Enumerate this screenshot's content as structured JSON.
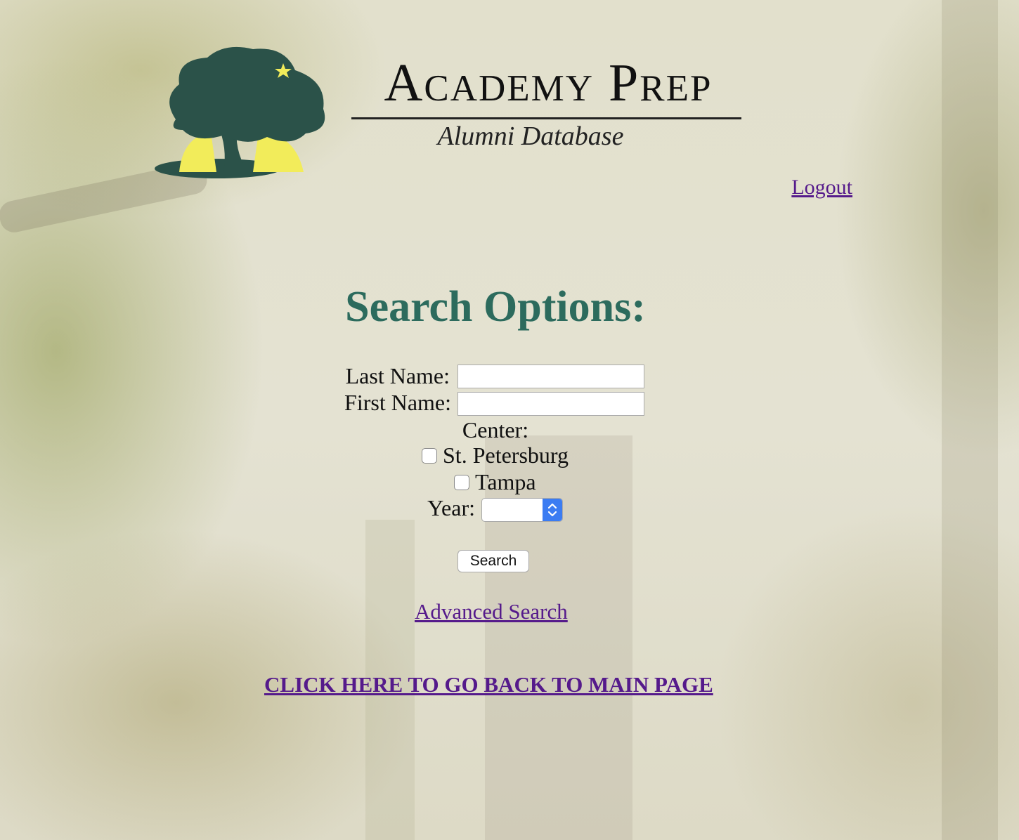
{
  "header": {
    "brand_title": "Academy Prep",
    "brand_subtitle": "Alumni Database",
    "logout_label": "Logout"
  },
  "main": {
    "heading": "Search Options:",
    "last_name_label": "Last Name:",
    "last_name_value": "",
    "first_name_label": "First Name:",
    "first_name_value": "",
    "center_label": "Center:",
    "centers": [
      {
        "label": "St. Petersburg",
        "checked": false
      },
      {
        "label": "Tampa",
        "checked": false
      }
    ],
    "year_label": "Year:",
    "year_value": "",
    "search_button_label": "Search",
    "advanced_search_label": "Advanced Search",
    "back_link_label": "CLICK HERE TO GO BACK TO MAIN PAGE"
  },
  "colors": {
    "heading": "#2c6b5d",
    "link": "#551a8b",
    "tree": "#2b5249",
    "tree_light": "#f2ec5a",
    "select_accent": "#3b7cf2"
  }
}
